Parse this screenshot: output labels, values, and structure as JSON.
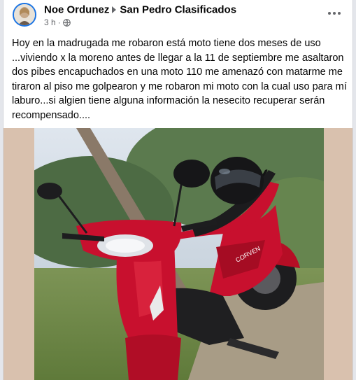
{
  "post": {
    "author": "Noe Ordunez",
    "group": "San Pedro Clasificados",
    "time": "3 h",
    "separator": "·",
    "body": "Hoy en la madrugada me robaron está moto  tiene dos meses de uso ...viviendo x la moreno antes de llegar a la 11 de septiembre me asaltaron dos pibes encapuchados en una moto 110 me amenazó con matarme me tiraron al piso me golpearon y me robaron mi moto con la cual uso para mí laburo...si algien tiene alguna información la nesecito recuperar serán recompensado....",
    "icons": {
      "privacy": "globe-icon",
      "menu": "more-options-icon",
      "share_arrow": "caret-right-icon"
    }
  },
  "photo": {
    "colors": {
      "bike_red": "#c8102e",
      "helmet": "#1c1c1e",
      "sky": "#cfd8e2",
      "grass": "#6f8d4a",
      "side_bg": "#d9c1ae"
    }
  }
}
